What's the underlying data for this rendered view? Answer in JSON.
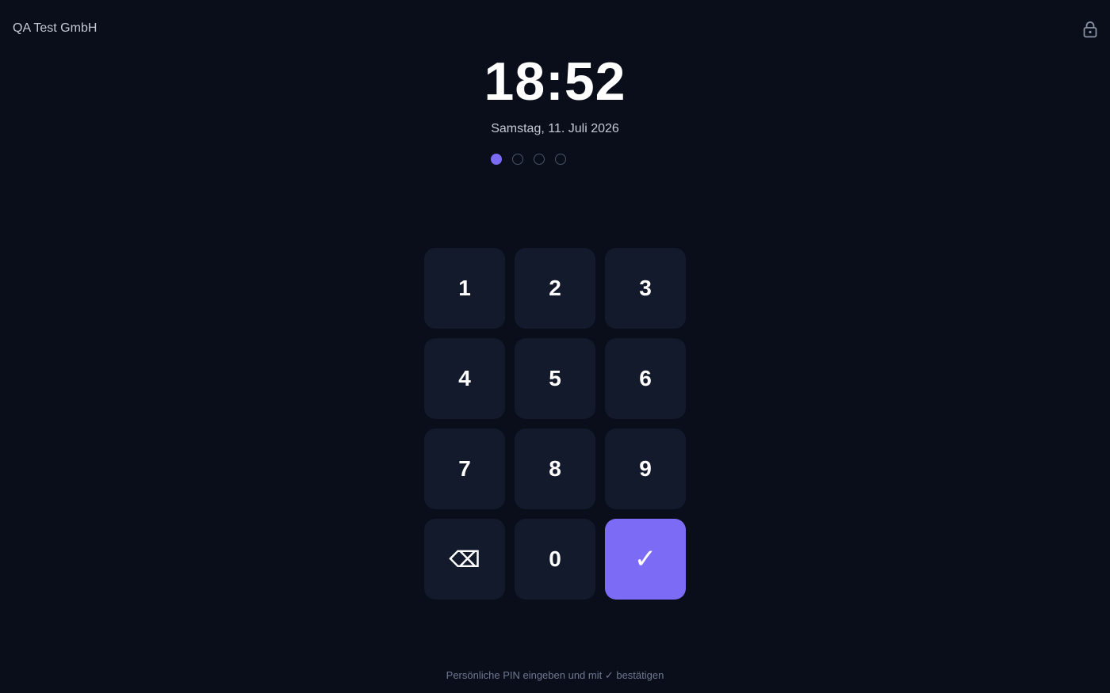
{
  "header": {
    "company": "QA Test GmbH",
    "lock_icon": "lock-icon"
  },
  "clock": {
    "time": "18:52",
    "date": "Samstag, 11. Juli 2026"
  },
  "pin": {
    "length": 4,
    "entered": 1
  },
  "keypad": {
    "k1": "1",
    "k2": "2",
    "k3": "3",
    "k4": "4",
    "k5": "5",
    "k6": "6",
    "k7": "7",
    "k8": "8",
    "k9": "9",
    "k0": "0",
    "backspace": "⌫",
    "confirm": "✓",
    "backspace_icon": "backspace-icon",
    "confirm_icon": "checkmark-icon"
  },
  "footer": {
    "hint": "Persönliche PIN eingeben und mit ✓ bestätigen"
  },
  "colors": {
    "background": "#0a0e1a",
    "key": "#131a2c",
    "accent": "#7c6cf5"
  }
}
